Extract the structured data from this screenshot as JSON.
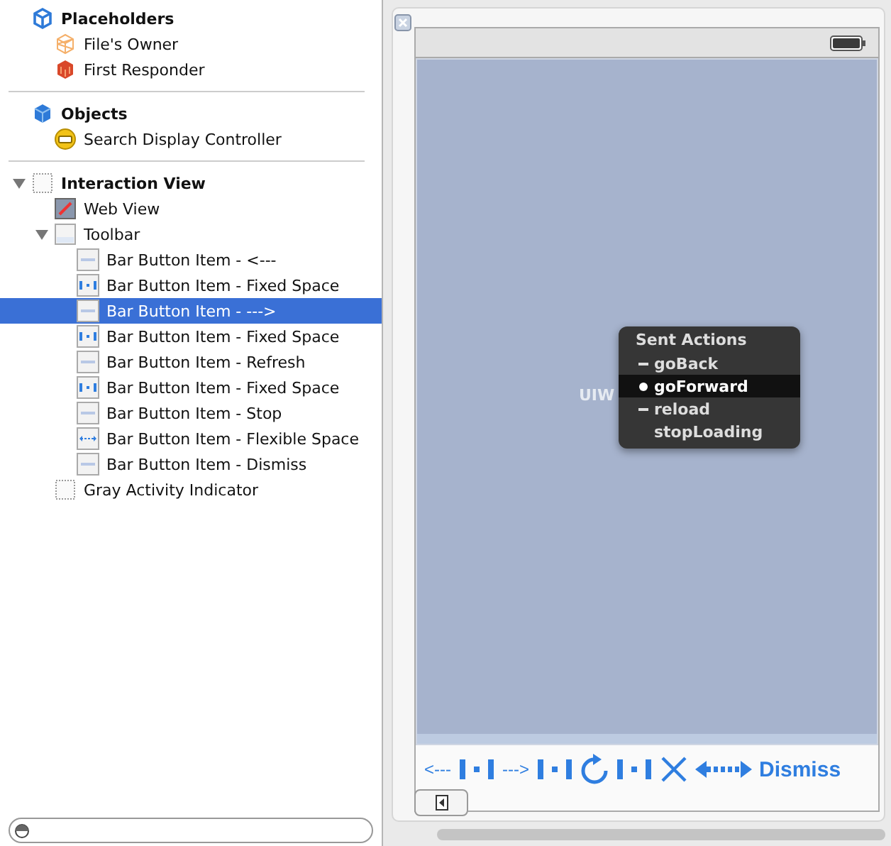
{
  "outline": {
    "sections": [
      {
        "title": "Placeholders",
        "kind": "cube",
        "items": [
          {
            "label": "File's Owner",
            "kind": "owner",
            "selected": false
          },
          {
            "label": "First Responder",
            "kind": "responder",
            "selected": false
          }
        ]
      },
      {
        "title": "Objects",
        "kind": "solid",
        "items": [
          {
            "label": "Search Display Controller",
            "kind": "controller",
            "selected": false
          }
        ]
      }
    ],
    "tree": [
      {
        "label": "Interaction View",
        "kind": "view",
        "expanded": true,
        "selected": false,
        "children": [
          {
            "label": "Web View",
            "kind": "webview",
            "selected": false
          },
          {
            "label": "Toolbar",
            "kind": "toolbar",
            "expanded": true,
            "selected": false,
            "children": [
              {
                "label": "Bar Button Item - <---",
                "kind": "button",
                "selected": false
              },
              {
                "label": "Bar Button Item - Fixed Space",
                "kind": "fixed",
                "selected": false
              },
              {
                "label": "Bar Button Item - --->",
                "kind": "button",
                "selected": true
              },
              {
                "label": "Bar Button Item - Fixed Space",
                "kind": "fixed",
                "selected": false
              },
              {
                "label": "Bar Button Item - Refresh",
                "kind": "button",
                "selected": false
              },
              {
                "label": "Bar Button Item - Fixed Space",
                "kind": "fixed",
                "selected": false
              },
              {
                "label": "Bar Button Item - Stop",
                "kind": "button",
                "selected": false
              },
              {
                "label": "Bar Button Item - Flexible Space",
                "kind": "flexible",
                "selected": false
              },
              {
                "label": "Bar Button Item - Dismiss",
                "kind": "button",
                "selected": false
              }
            ]
          },
          {
            "label": "Gray Activity Indicator",
            "kind": "view",
            "selected": false
          }
        ]
      }
    ]
  },
  "canvas": {
    "view_label": "UIW",
    "menu": {
      "title": "Sent Actions",
      "items": [
        {
          "label": "goBack",
          "kind": "dash",
          "selected": false
        },
        {
          "label": "goForward",
          "kind": "dot",
          "selected": true
        },
        {
          "label": "reload",
          "kind": "dash",
          "selected": false
        },
        {
          "label": "stopLoading",
          "kind": "none",
          "selected": false
        }
      ]
    },
    "toolbar": [
      {
        "kind": "text",
        "label": "<---"
      },
      {
        "kind": "fixed"
      },
      {
        "kind": "text",
        "label": "--->"
      },
      {
        "kind": "fixed"
      },
      {
        "kind": "refresh"
      },
      {
        "kind": "fixed"
      },
      {
        "kind": "stop"
      },
      {
        "kind": "flexible"
      },
      {
        "kind": "done",
        "label": "Dismiss"
      }
    ]
  }
}
